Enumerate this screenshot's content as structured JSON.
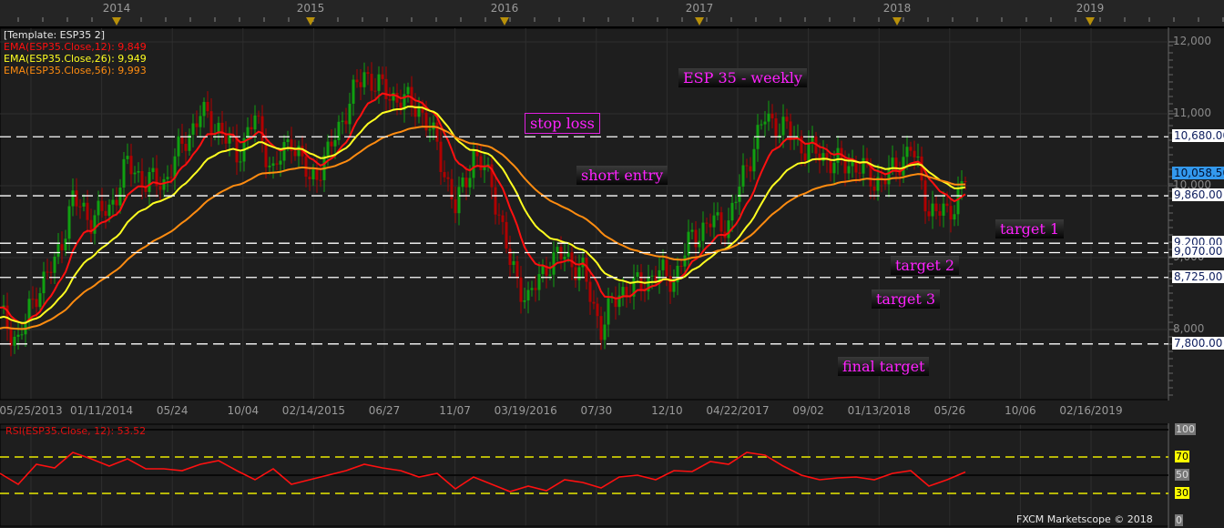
{
  "chart_data": {
    "type": "candlestick",
    "title": "ESP 35 - weekly",
    "template": "[Template: ESP35 2]",
    "step_weeks": 5,
    "closes": [
      8215,
      7835,
      8530,
      8910,
      9800,
      9550,
      9670,
      10300,
      10050,
      10050,
      10560,
      11000,
      10810,
      10430,
      10940,
      10180,
      10680,
      10050,
      10430,
      11060,
      11570,
      11320,
      11190,
      11100,
      10550,
      9670,
      10430,
      10050,
      8910,
      8400,
      8910,
      9040,
      8785,
      8025,
      8530,
      8600,
      8785,
      8700,
      9290,
      9480,
      9480,
      10300,
      10940,
      10810,
      10560,
      10430,
      10300,
      10300,
      10050,
      10180,
      10560,
      9670,
      9600,
      10058.5
    ],
    "ylim": [
      7300,
      12400
    ],
    "y_ticks": [
      "12,000",
      "11,000",
      "10,000",
      "9,000",
      "8,000"
    ],
    "y_tick_values": [
      12000,
      11000,
      10000,
      9000,
      8000
    ],
    "x_labels": [
      "05/25/2013",
      "01/11/2014",
      "05/24",
      "10/04",
      "02/14/2015",
      "06/27",
      "11/07",
      "03/19/2016",
      "07/30",
      "12/10",
      "04/22/2017",
      "09/02",
      "01/13/2018",
      "05/26",
      "10/06",
      "02/16/2019"
    ],
    "years": [
      "2014",
      "2015",
      "2016",
      "2017",
      "2018",
      "2019"
    ],
    "indicators": [
      {
        "label": "EMA(ESP35.Close,12): 9,849",
        "period": 12,
        "color": "#ff1010"
      },
      {
        "label": "EMA(ESP35.Close,26): 9,949",
        "period": 26,
        "color": "#ffff20"
      },
      {
        "label": "EMA(ESP35.Close,56): 9,993",
        "period": 56,
        "color": "#ff8c10"
      }
    ],
    "levels": [
      {
        "value": 10680,
        "label": "10,680.00"
      },
      {
        "value": 9860,
        "label": "9,860.00"
      },
      {
        "value": 9200,
        "label": "9,200.00"
      },
      {
        "value": 9070,
        "label": "9,070.00"
      },
      {
        "value": 8725,
        "label": "8,725.00"
      },
      {
        "value": 7800,
        "label": "7,800.00"
      }
    ],
    "last_price": "10,058.50",
    "annotations": {
      "title": "ESP 35 - weekly",
      "stop_loss": "stop loss",
      "short_entry": "short entry",
      "target1": "target 1",
      "target2": "target 2",
      "target3": "target 3",
      "final": "final target"
    },
    "rsi": {
      "label": "RSI(ESP35.Close, 12): 53.52",
      "values": [
        52,
        40,
        62,
        58,
        75,
        68,
        60,
        68,
        57,
        57,
        55,
        62,
        66,
        55,
        45,
        57,
        40,
        45,
        50,
        55,
        62,
        58,
        55,
        48,
        52,
        35,
        48,
        40,
        32,
        38,
        33,
        45,
        42,
        36,
        48,
        50,
        45,
        55,
        54,
        65,
        62,
        75,
        72,
        60,
        50,
        45,
        47,
        48,
        45,
        52,
        55,
        38,
        45,
        53.52
      ],
      "levels": [
        "100",
        "70",
        "50",
        "30",
        "0"
      ]
    }
  },
  "footer": "FXCM Marketscope © 2018"
}
